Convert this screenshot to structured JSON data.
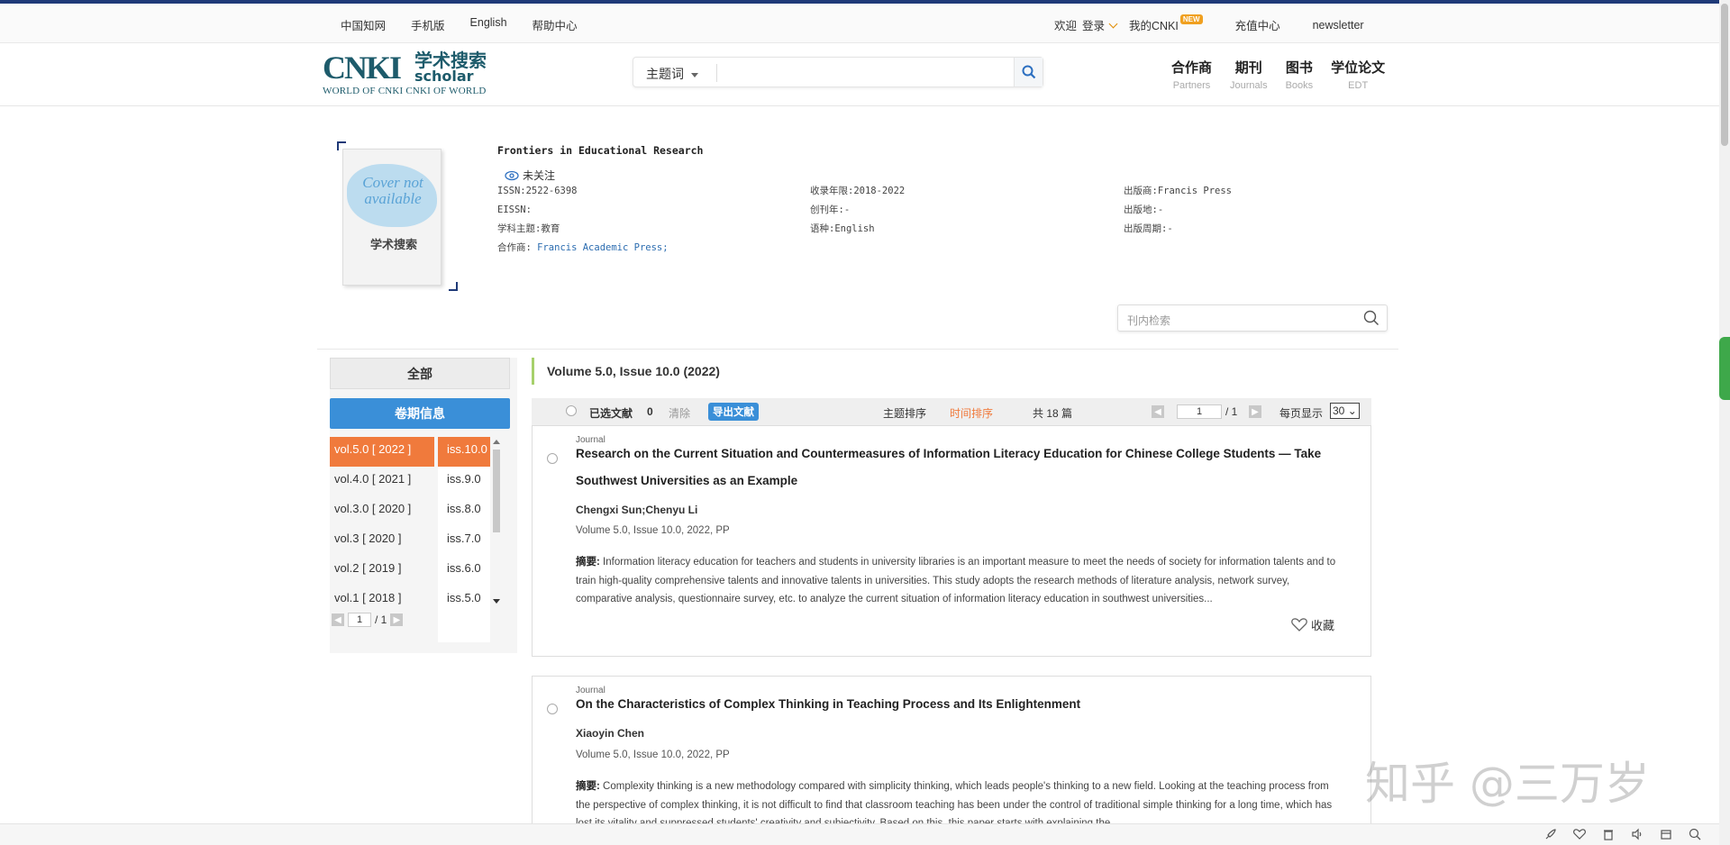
{
  "topbar": {
    "left_links": [
      "中国知网",
      "手机版",
      "English",
      "帮助中心"
    ],
    "welcome": "欢迎",
    "login": "登录",
    "my_cnki": "我的CNKI",
    "new_badge": "NEW",
    "recharge": "充值中心",
    "newsletter": "newsletter"
  },
  "logo": {
    "main": "CNKI",
    "cn": "学术搜索",
    "scholar": "scholar",
    "subtitle": "WORLD OF CNKI CNKI OF WORLD"
  },
  "search": {
    "type_label": "主题词",
    "value": ""
  },
  "nav": [
    {
      "title": "合作商",
      "sub": "Partners"
    },
    {
      "title": "期刊",
      "sub": "Journals"
    },
    {
      "title": "图书",
      "sub": "Books"
    },
    {
      "title": "学位论文",
      "sub": "EDT"
    }
  ],
  "journal": {
    "cover_text": "Cover not available",
    "cover_logo": "学术搜索",
    "title": "Frontiers in Educational Research",
    "follow_label": "未关注",
    "col1": [
      "ISSN:2522-6398",
      "EISSN:",
      "学科主题:教育"
    ],
    "partner_label": "合作商:",
    "partner_value": "Francis Academic Press;",
    "col2": [
      "收录年限:2018-2022",
      "创刊年:-",
      "语种:English"
    ],
    "col3": [
      "出版商:Francis Press",
      "出版地:-",
      "出版周期:-"
    ]
  },
  "inner_search": {
    "placeholder": "刊内检索"
  },
  "sidebar": {
    "all_label": "全部",
    "volume_label": "卷期信息",
    "volumes": [
      "vol.5.0 [ 2022 ]",
      "vol.4.0 [ 2021 ]",
      "vol.3.0 [ 2020 ]",
      "vol.3 [ 2020 ]",
      "vol.2 [ 2019 ]",
      "vol.1 [ 2018 ]"
    ],
    "issues": [
      "iss.10.0",
      "iss.9.0",
      "iss.8.0",
      "iss.7.0",
      "iss.6.0",
      "iss.5.0"
    ],
    "page": "1",
    "page_total": "/ 1"
  },
  "issue_heading": "Volume 5.0, Issue 10.0 (2022)",
  "toolbar": {
    "selected_label": "已选文献",
    "selected_count": "0",
    "clear_label": "清除",
    "export_label": "导出文献",
    "sort_topic": "主题排序",
    "sort_time": "时间排序",
    "total": "共 18 篇",
    "page": "1",
    "page_total": "/ 1",
    "per_page_label": "每页显示",
    "per_page_value": "30"
  },
  "articles": [
    {
      "kind": "Journal",
      "title": "Research on the Current Situation and Countermeasures of Information Literacy Education for Chinese College Students — Take Southwest Universities as an Example",
      "authors": "Chengxi Sun;Chenyu Li",
      "volume": "Volume 5.0, Issue 10.0, 2022, PP",
      "abstract_label": "摘要:",
      "abstract": "Information literacy education for teachers and students in university libraries is an important measure to meet the needs of society for information talents and to train high-quality comprehensive talents and innovative talents in universities. This study adopts the research methods of literature analysis, network survey, comparative analysis, questionnaire survey, etc. to analyze the current situation of information literacy education in southwest universities...",
      "fav_label": "收藏"
    },
    {
      "kind": "Journal",
      "title": "On the Characteristics of Complex Thinking in Teaching Process and Its Enlightenment",
      "authors": "Xiaoyin Chen",
      "volume": "Volume 5.0, Issue 10.0, 2022, PP",
      "abstract_label": "摘要:",
      "abstract": "Complexity thinking is a new methodology compared with simplicity thinking, which leads people's thinking to a new field. Looking at the teaching process from the perspective of complex thinking, it is not difficult to find that classroom teaching has been under the control of traditional simple thinking for a long time, which has lost its vitality and suppressed students' creativity and subjectivity. Based on this, this paper starts with explaining the..."
    }
  ],
  "watermark": "知乎 @三万岁",
  "colors": {
    "accent_blue": "#3a8fd8",
    "active_orange": "#f07a3c",
    "brand_teal": "#1d5b6b",
    "sort_active": "#f07a3c"
  }
}
